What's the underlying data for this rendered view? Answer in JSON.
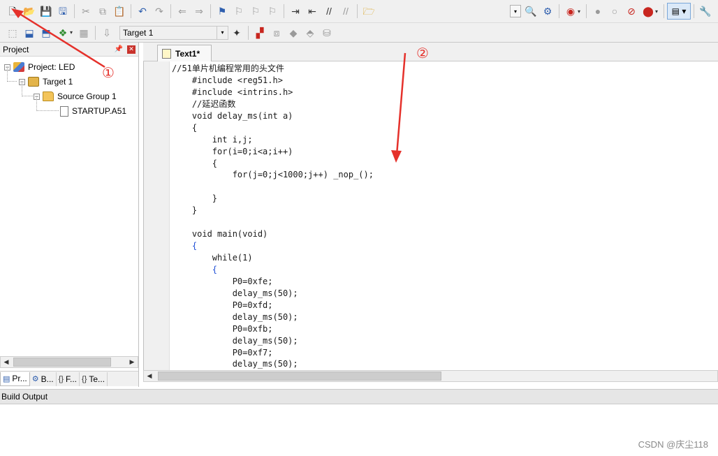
{
  "toolbar2": {
    "target_name": "Target 1"
  },
  "project_panel": {
    "title": "Project",
    "tree": [
      {
        "label": "Project: LED"
      },
      {
        "label": "Target 1"
      },
      {
        "label": "Source Group 1"
      },
      {
        "label": "STARTUP.A51"
      }
    ],
    "tabs": [
      {
        "label": "Pr...",
        "icon": "books-icon"
      },
      {
        "label": "B...",
        "icon": "gears-icon"
      },
      {
        "label": "F...",
        "icon": "braces-icon"
      },
      {
        "label": "Te...",
        "icon": "template-icon"
      }
    ]
  },
  "editor": {
    "tab_label": "Text1*",
    "code_lines": [
      {
        "text": "//51单片机编程常用的头文件",
        "color": "dark"
      },
      {
        "text": "    #include <reg51.h>",
        "color": "dark"
      },
      {
        "text": "    #include <intrins.h>",
        "color": "dark"
      },
      {
        "text": "    //延迟函数",
        "color": "dark"
      },
      {
        "text": "    void delay_ms(int a)",
        "color": "dark"
      },
      {
        "text": "    {",
        "color": "dark"
      },
      {
        "text": "        int i,j;",
        "color": "dark"
      },
      {
        "text": "        for(i=0;i<a;i++)",
        "color": "dark"
      },
      {
        "text": "        {",
        "color": "dark"
      },
      {
        "text": "            for(j=0;j<1000;j++) _nop_();",
        "color": "dark"
      },
      {
        "text": "",
        "color": "dark"
      },
      {
        "text": "        }",
        "color": "dark"
      },
      {
        "text": "    }",
        "color": "dark"
      },
      {
        "text": "",
        "color": "dark"
      },
      {
        "text": "    void main(void)",
        "color": "dark"
      },
      {
        "text": "    {",
        "color": "blue"
      },
      {
        "text": "        while(1)",
        "color": "dark"
      },
      {
        "text": "        {",
        "color": "blue"
      },
      {
        "text": "            P0=0xfe;",
        "color": "dark"
      },
      {
        "text": "            delay_ms(50);",
        "color": "dark"
      },
      {
        "text": "            P0=0xfd;",
        "color": "dark"
      },
      {
        "text": "            delay_ms(50);",
        "color": "dark"
      },
      {
        "text": "            P0=0xfb;",
        "color": "dark"
      },
      {
        "text": "            delay_ms(50);",
        "color": "dark"
      },
      {
        "text": "            P0=0xf7;",
        "color": "dark"
      },
      {
        "text": "            delay_ms(50);",
        "color": "dark"
      }
    ]
  },
  "build_output": {
    "label": "Build Output"
  },
  "annotations": {
    "marker_1": "①",
    "marker_2": "②",
    "arrow_color": "#e5312b"
  },
  "watermark": "CSDN @庆尘118"
}
